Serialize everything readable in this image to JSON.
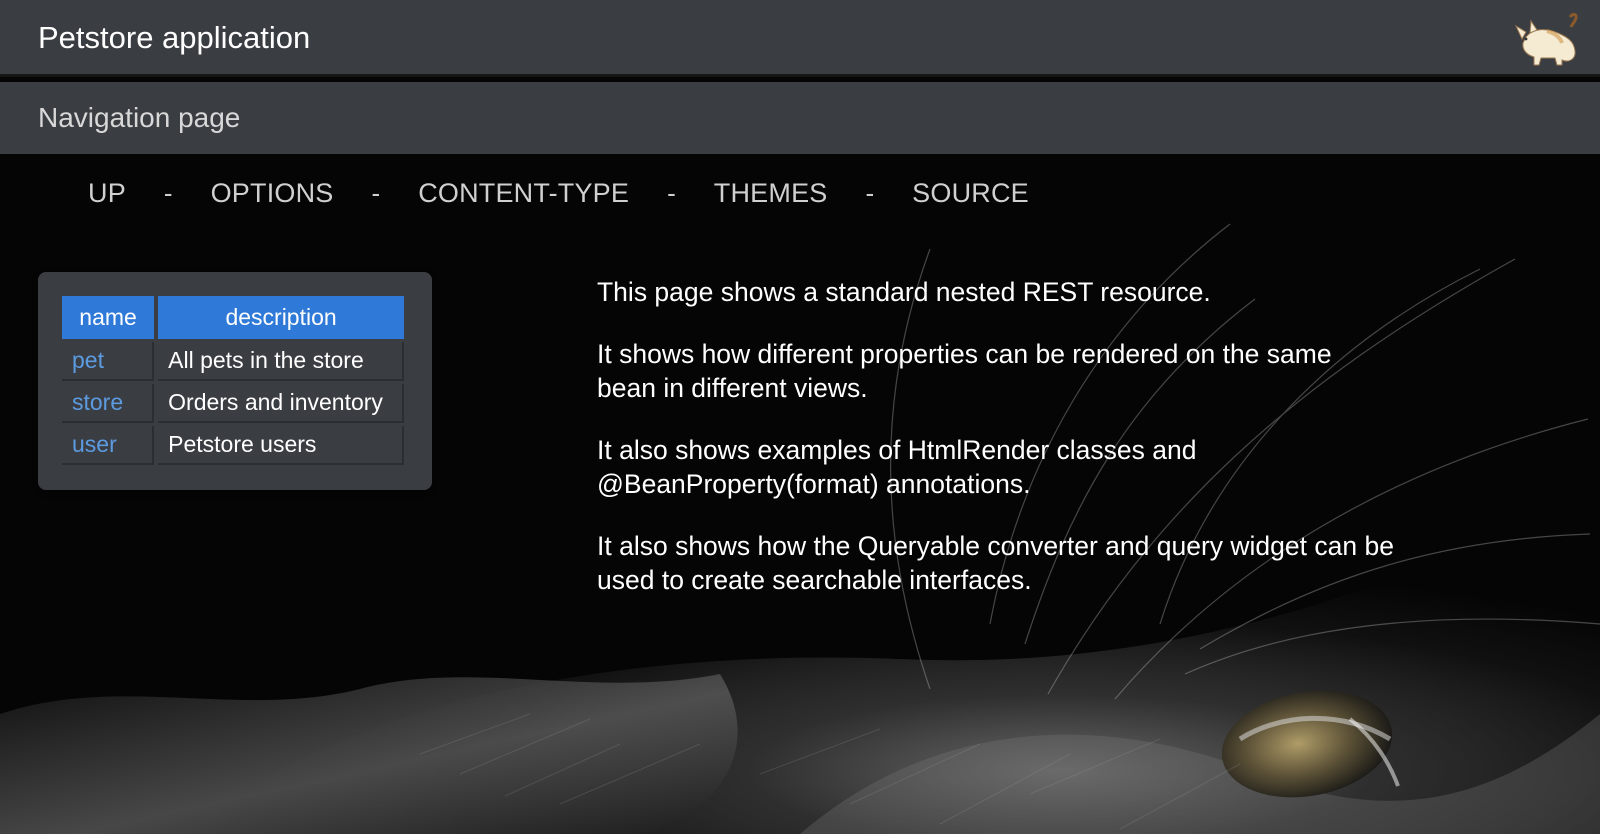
{
  "header": {
    "title": "Petstore application"
  },
  "subheader": {
    "title": "Navigation page"
  },
  "nav": {
    "links": [
      "UP",
      "OPTIONS",
      "CONTENT-TYPE",
      "THEMES",
      "SOURCE"
    ],
    "separator": "-"
  },
  "resources": {
    "columns": [
      "name",
      "description"
    ],
    "rows": [
      {
        "name": "pet",
        "description": "All pets in the store"
      },
      {
        "name": "store",
        "description": "Orders and inventory"
      },
      {
        "name": "user",
        "description": "Petstore users"
      }
    ]
  },
  "description": {
    "paragraphs": [
      "This page shows a standard nested REST resource.",
      "It shows how different properties can be rendered on the same bean in different views.",
      "It also shows examples of HtmlRender classes and @BeanProperty(format) annotations.",
      "It also shows how the Queryable converter and query widget can be used to create searchable interfaces."
    ]
  },
  "icons": {
    "logo": "cat-logo-icon",
    "background": "cat-photo-background"
  },
  "colors": {
    "header_bg": "#3a3d42",
    "accent": "#2f7ad8",
    "link": "#5d9be1",
    "page_bg": "#050505"
  }
}
